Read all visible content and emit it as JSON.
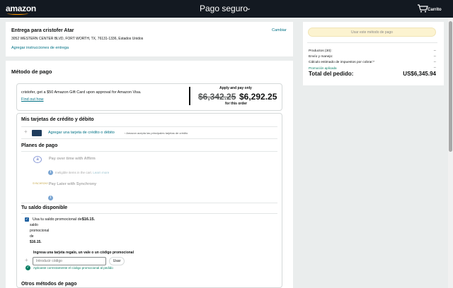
{
  "header": {
    "logo": "amazon",
    "title": "Pago seguro",
    "cart_label": "Carrito"
  },
  "address": {
    "name": "Entrega para cristofer Atar",
    "line": "3052 WESTERN CENTER BLVD, FORT WORTH, TX, 76131-1336, Estados Unidos",
    "change_label": "Cambiar",
    "instructions_label": "Agregar instrucciones de entrega"
  },
  "payment": {
    "title": "Método de pago",
    "promo": {
      "text": "cristofer, get a $50 Amazon Gift Card upon approval for Amazon Visa.",
      "link": "Find out how",
      "apply_label": "Apply and pay only",
      "old_price": "$6,342.25",
      "new_price": "$6,292.25",
      "for_order": "for this order"
    },
    "cards": {
      "title": "Mis tarjetas de crédito y débito",
      "add_label": "Agregar una tarjeta de crédito o débito",
      "add_note": "› Amazon acepta las principales tarjetas de crédito"
    },
    "plans": {
      "title": "Planes de pago",
      "affirm_label": "Pay over time with Affirm",
      "affirm_note": "Ineligible items in the cart.",
      "affirm_learn": "Learn more",
      "synchrony_label": "Pay Later with Synchrony"
    },
    "balance": {
      "title": "Tu saldo disponible",
      "use_text": "Usa tu saldo promocional de",
      "amount": "$16.15.",
      "sub_1": "saldo",
      "sub_2": "promocional",
      "sub_3": "de",
      "sub_4": "$16.15.",
      "gift_label": "Ingresa una tarjeta regalo, un vale o un código promocional",
      "input_placeholder": "Introducir código",
      "use_button": "Usar",
      "success_text": "Aplicaste correctamente el código promocional al pedido"
    },
    "other_title": "Otros métodos de pago"
  },
  "summary": {
    "use_method_button": "Usar este método de pago",
    "rows": [
      {
        "label": "Productos (30):",
        "value": "--"
      },
      {
        "label": "Envío y manejo:",
        "value": "--"
      },
      {
        "label": "Cálculo estimado de impuestos por cobrar:*",
        "value": "--"
      }
    ],
    "promo_label": "Promoción aplicada",
    "promo_value": "--",
    "total_label": "Total del pedido:",
    "total_value": "US$6,345.94"
  }
}
